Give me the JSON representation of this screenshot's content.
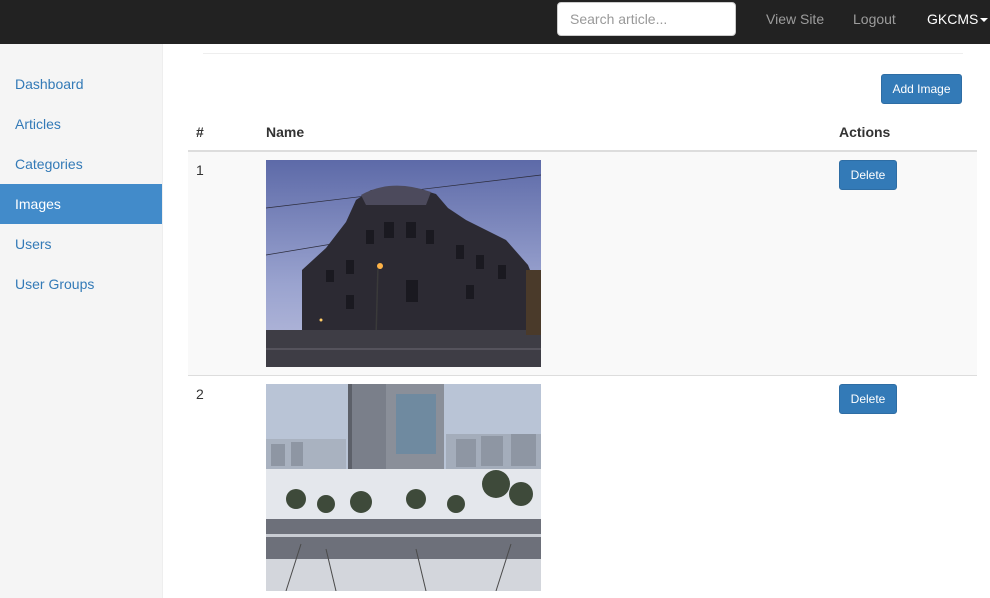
{
  "navbar": {
    "search_placeholder": "Search article...",
    "view_site": "View Site",
    "logout": "Logout",
    "brand": "GKCMS"
  },
  "sidebar": {
    "items": [
      {
        "label": "Dashboard"
      },
      {
        "label": "Articles"
      },
      {
        "label": "Categories"
      },
      {
        "label": "Images",
        "active": true
      },
      {
        "label": "Users"
      },
      {
        "label": "User Groups"
      }
    ]
  },
  "main": {
    "add_button": "Add Image",
    "columns": [
      "#",
      "Name",
      "Actions"
    ],
    "rows": [
      {
        "num": "1",
        "action": "Delete",
        "image": "dusk-building-photo"
      },
      {
        "num": "2",
        "action": "Delete",
        "image": "snowy-city-tower-photo"
      }
    ]
  },
  "colors": {
    "navbar_bg": "#222222",
    "accent": "#337ab7",
    "active_sidebar": "#428bca"
  }
}
